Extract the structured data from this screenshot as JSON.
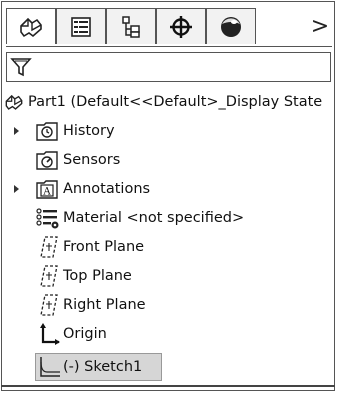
{
  "tabs": [
    {
      "icon": "feature-manager-icon",
      "active": true
    },
    {
      "icon": "property-manager-icon",
      "active": false
    },
    {
      "icon": "configuration-manager-icon",
      "active": false
    },
    {
      "icon": "dimxpert-manager-icon",
      "active": false
    },
    {
      "icon": "display-manager-icon",
      "active": false
    }
  ],
  "tab_scroll_glyph": ">",
  "filter": {
    "icon": "filter-icon"
  },
  "tree": {
    "root": {
      "label": "Part1  (Default<<Default>_Display State",
      "icon": "part-icon"
    },
    "items": [
      {
        "label": "History",
        "icon": "history-icon",
        "expandable": true
      },
      {
        "label": "Sensors",
        "icon": "sensors-icon",
        "expandable": false
      },
      {
        "label": "Annotations",
        "icon": "annotations-icon",
        "expandable": true
      },
      {
        "label": "Material <not specified>",
        "icon": "material-icon",
        "expandable": false
      },
      {
        "label": "Front Plane",
        "icon": "plane-icon",
        "expandable": false
      },
      {
        "label": "Top Plane",
        "icon": "plane-icon",
        "expandable": false
      },
      {
        "label": "Right Plane",
        "icon": "plane-icon",
        "expandable": false
      },
      {
        "label": "Origin",
        "icon": "origin-icon",
        "expandable": false
      },
      {
        "label": "(-) Sketch1",
        "icon": "sketch-icon",
        "expandable": false,
        "selected": true
      }
    ]
  }
}
